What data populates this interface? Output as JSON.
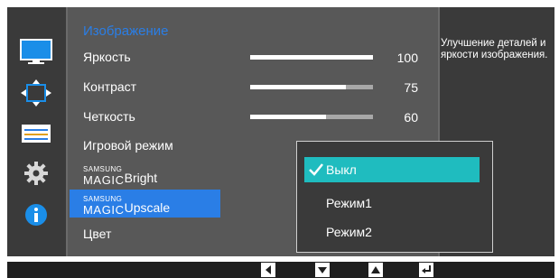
{
  "menu": {
    "title": "Изображение",
    "items": [
      {
        "label": "Яркость",
        "value": "100",
        "level": 1.0
      },
      {
        "label": "Контраст",
        "value": "75",
        "level": 0.78
      },
      {
        "label": "Четкость",
        "value": "60",
        "level": 0.62
      },
      {
        "label": "Игровой режим"
      },
      {
        "brand_top": "SAMSUNG",
        "brand_main": "MAGIC",
        "label": "Bright"
      },
      {
        "brand_top": "SAMSUNG",
        "brand_main": "MAGIC",
        "label": "Upscale",
        "selected": true
      },
      {
        "label": "Цвет"
      }
    ]
  },
  "dropdown": {
    "options": [
      {
        "label": "Выкл",
        "selected": true
      },
      {
        "label": "Режим1"
      },
      {
        "label": "Режим2"
      }
    ]
  },
  "description": "Улучшение деталей и яркости изображения.",
  "sidebar_icons": [
    "monitor-icon",
    "move-arrows-icon",
    "menu-lines-icon",
    "gear-icon",
    "info-icon"
  ],
  "bottom_buttons": [
    "left-arrow-icon",
    "down-arrow-icon",
    "up-arrow-icon",
    "enter-icon"
  ],
  "colors": {
    "highlight": "#2a7ee6",
    "active_option": "#1fbcbf",
    "panel": "#585858",
    "background": "#3a3a3a"
  }
}
